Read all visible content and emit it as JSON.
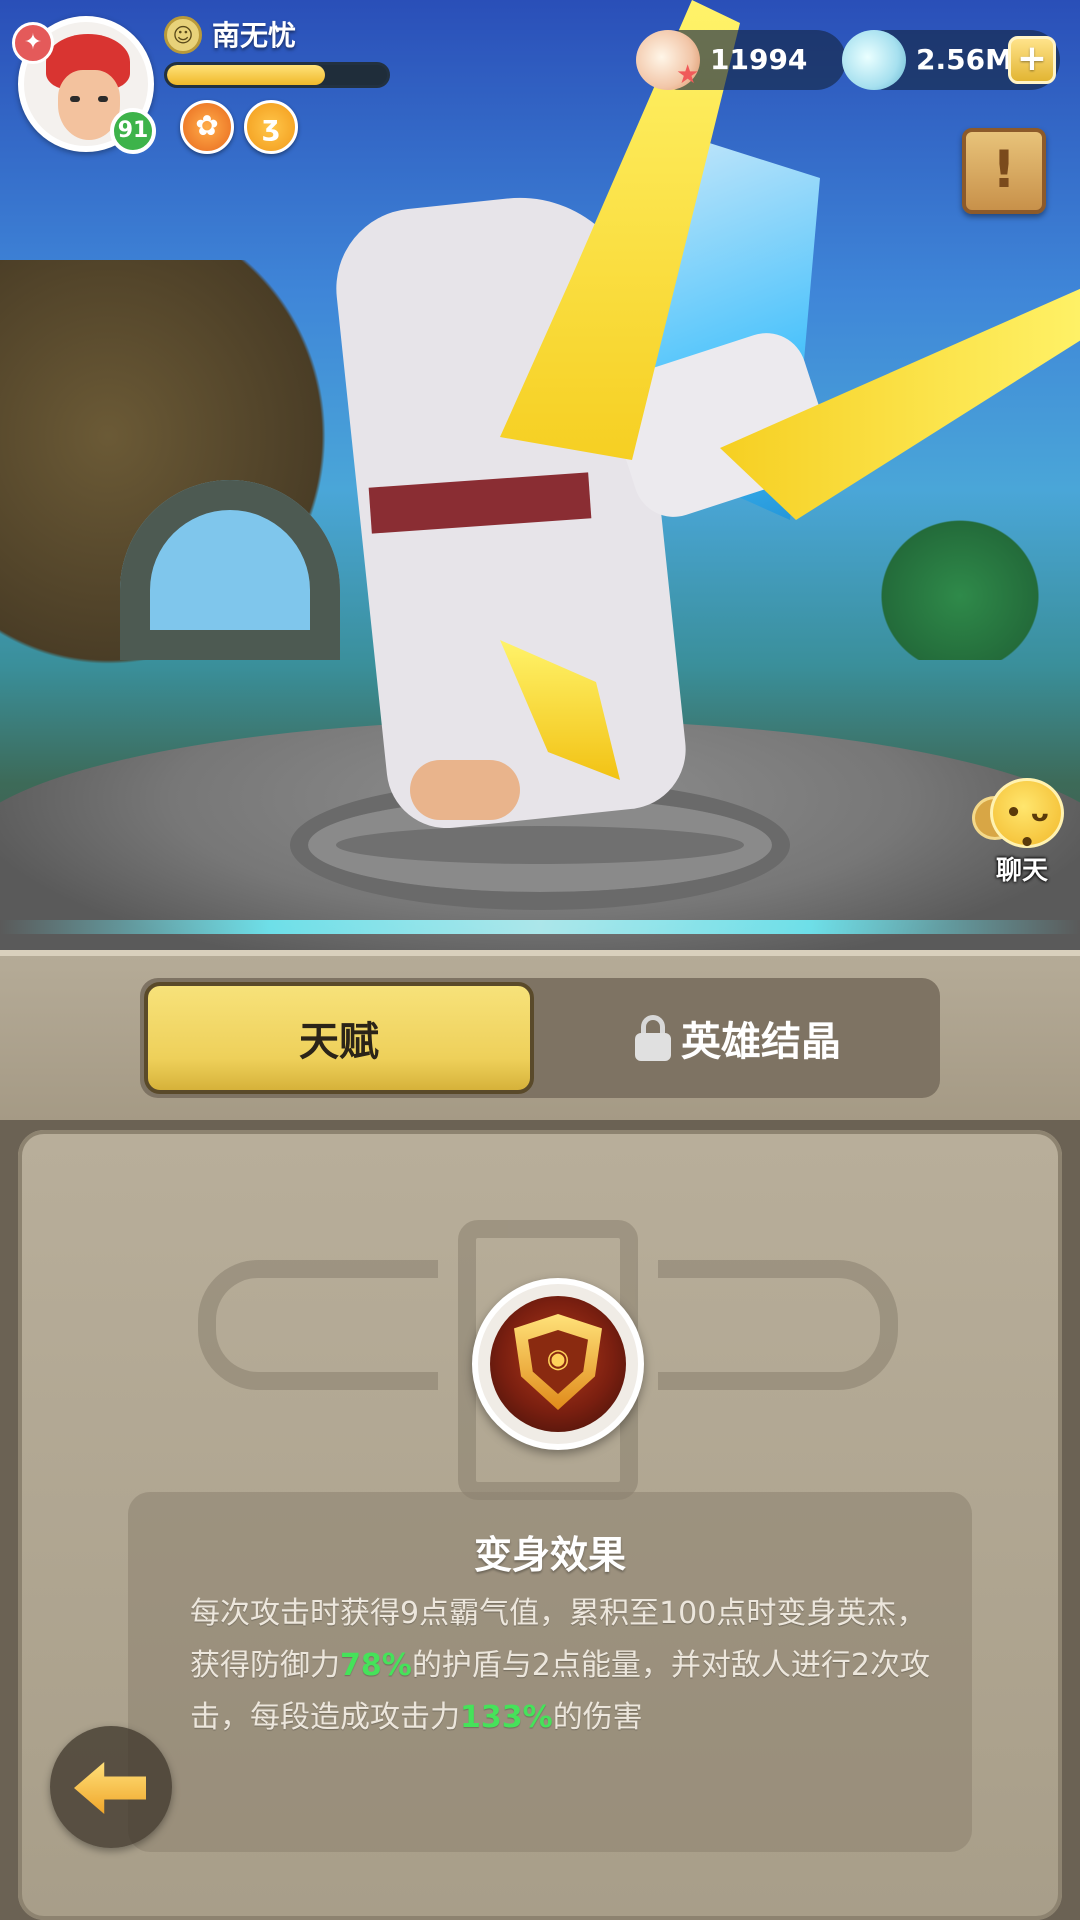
{
  "player": {
    "name": "南无忧",
    "level": "91",
    "rank_icon": "rank-emblem-icon",
    "xp_fraction": 0.72,
    "buffs": [
      {
        "icon": "buff-orange-badge-icon",
        "glyph": "✿"
      },
      {
        "icon": "buff-speed-badge-icon",
        "glyph": "ʒ"
      }
    ]
  },
  "currencies": [
    {
      "icon": "shell-pearl-icon",
      "value": "11994"
    },
    {
      "icon": "clam-gem-icon",
      "value": "2.56M",
      "has_add_button": true
    }
  ],
  "add_button_glyph": "+",
  "quest_icon_glyph": "!",
  "chat": {
    "label": "聊天",
    "face": "• ᴗ •"
  },
  "tabs": {
    "active": "天赋",
    "locked": "英雄结晶"
  },
  "talent": {
    "title": "变身效果",
    "desc": {
      "p1": "每次攻击时获得9点霸气值，累积至100点时变身英杰，获得防御力",
      "v1": "78%",
      "p2": "的护盾与2点能量，并对敌人进行2次攻击，每段造成攻击力",
      "v2": "133%",
      "p3": "的伤害"
    }
  },
  "colors": {
    "highlight_green": "#46e25a",
    "tab_active_yellow": "#eed05a",
    "panel_stone": "#a89e89"
  }
}
